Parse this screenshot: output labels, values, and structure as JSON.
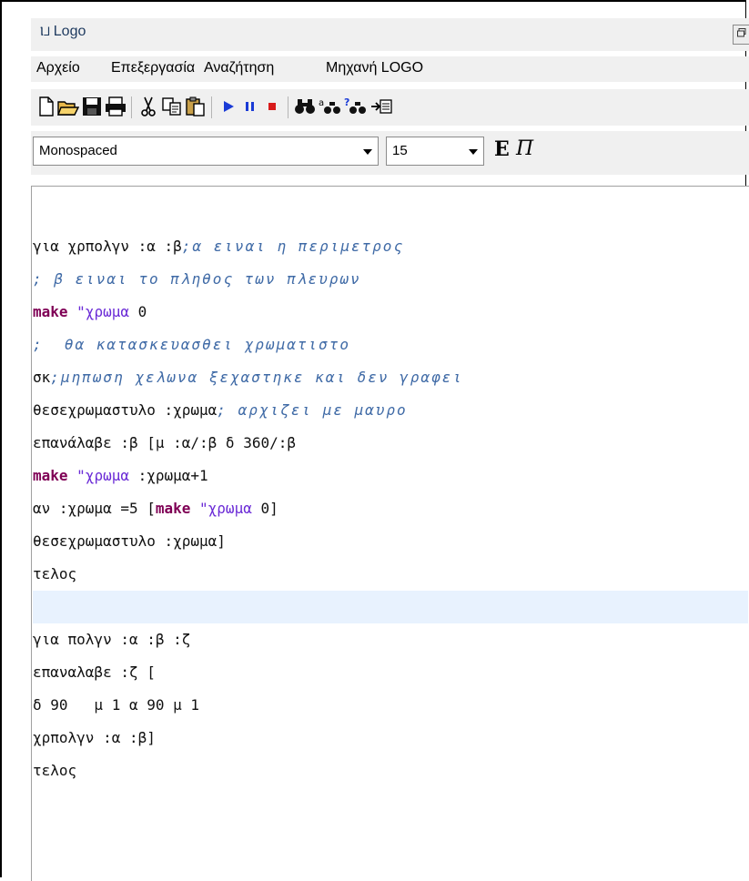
{
  "window": {
    "title": "Logo",
    "title_glyph": "Ⲓ⅃"
  },
  "menu": [
    "Αρχείο",
    "Επεξεργασία",
    "Αναζήτηση",
    "Μηχανή LOGO"
  ],
  "toolbar": {
    "icons": [
      "new-file-icon",
      "open-folder-icon",
      "save-icon",
      "print-icon",
      "cut-icon",
      "copy-icon",
      "paste-icon",
      "run-icon",
      "pause-icon",
      "stop-icon",
      "find-icon",
      "find-replace-icon",
      "find-help-icon",
      "goto-icon"
    ]
  },
  "format": {
    "font_family": "Monospaced",
    "font_size": "15",
    "bold_label": "E",
    "italic_label": "Π"
  },
  "editor": {
    "lines": [
      [],
      [
        {
          "t": "για χρπολγν :α :β",
          "c": ""
        },
        {
          "t": ";α ειναι η περιμετρος",
          "c": "cmt"
        }
      ],
      [
        {
          "t": "; β ειναι το πληθος των πλευρων",
          "c": "cmt"
        }
      ],
      [
        {
          "t": "make",
          "c": "kw"
        },
        {
          "t": " ",
          "c": ""
        },
        {
          "t": "\"χρωμα",
          "c": "str"
        },
        {
          "t": " 0",
          "c": ""
        }
      ],
      [
        {
          "t": ";  θα κατασκευασθει χρωματιστο",
          "c": "cmt"
        }
      ],
      [
        {
          "t": "σκ",
          "c": ""
        },
        {
          "t": ";μηπωση χελωνα ξεχαστηκε και δεν γραφει",
          "c": "cmt"
        }
      ],
      [
        {
          "t": "θεσεχρωμαστυλο :χρωμα",
          "c": ""
        },
        {
          "t": "; αρχιζει με μαυρο",
          "c": "cmt"
        }
      ],
      [
        {
          "t": "επανάλαβε :β [μ :α/:β δ 360/:β",
          "c": ""
        }
      ],
      [
        {
          "t": "make",
          "c": "kw"
        },
        {
          "t": " ",
          "c": ""
        },
        {
          "t": "\"χρωμα",
          "c": "str"
        },
        {
          "t": " :χρωμα+1",
          "c": ""
        }
      ],
      [
        {
          "t": "αν :χρωμα =5 [",
          "c": ""
        },
        {
          "t": "make",
          "c": "kw"
        },
        {
          "t": " ",
          "c": ""
        },
        {
          "t": "\"χρωμα",
          "c": "str"
        },
        {
          "t": " 0]",
          "c": ""
        }
      ],
      [
        {
          "t": "θεσεχρωμαστυλο :χρωμα]",
          "c": ""
        }
      ],
      [
        {
          "t": "τελος",
          "c": ""
        }
      ],
      [],
      [
        {
          "t": "για πολγν :α :β :ζ",
          "c": ""
        }
      ],
      [
        {
          "t": "επαναλαβε :ζ [",
          "c": ""
        }
      ],
      [
        {
          "t": "δ 90   μ 1 α 90 μ 1",
          "c": ""
        }
      ],
      [
        {
          "t": "χρπολγν :α :β]",
          "c": ""
        }
      ],
      [
        {
          "t": "τελος",
          "c": ""
        }
      ]
    ],
    "highlighted_line": 12
  }
}
